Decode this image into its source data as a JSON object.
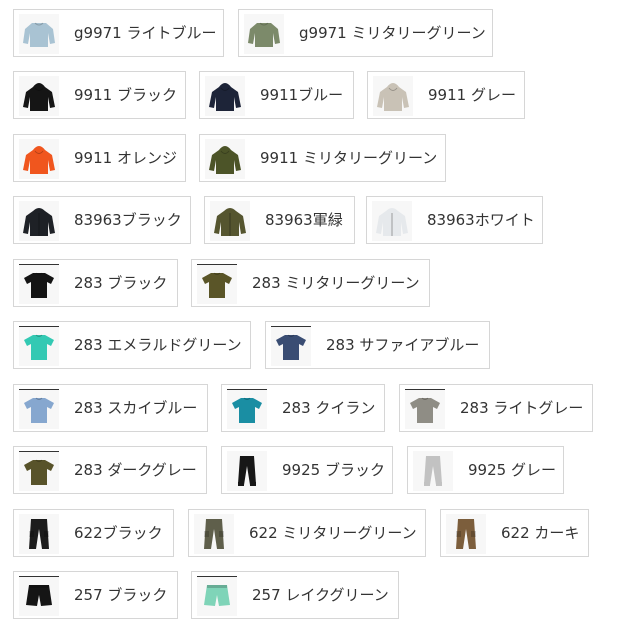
{
  "options": [
    {
      "label": "g9971 ライトブルー",
      "icon": "sweatshirt-icon",
      "color": "#a9c3d3"
    },
    {
      "label": "g9971 ミリタリーグリーン",
      "icon": "sweatshirt-icon",
      "color": "#7c8a6a"
    },
    {
      "label": "9911 ブラック",
      "icon": "hoodie-icon",
      "color": "#151515"
    },
    {
      "label": "9911ブルー",
      "icon": "hoodie-icon",
      "color": "#1d2438"
    },
    {
      "label": "9911 グレー",
      "icon": "hoodie-icon",
      "color": "#c9c2b6"
    },
    {
      "label": "9911 オレンジ",
      "icon": "hoodie-icon",
      "color": "#f0561e"
    },
    {
      "label": "9911 ミリタリーグリーン",
      "icon": "hoodie-icon",
      "color": "#4c5428"
    },
    {
      "label": "83963ブラック",
      "icon": "jacket-icon",
      "color": "#1e2126"
    },
    {
      "label": "83963軍緑",
      "icon": "jacket-icon",
      "color": "#55552f"
    },
    {
      "label": "83963ホワイト",
      "icon": "jacket-icon",
      "color": "#e6e9ec"
    },
    {
      "label": "283 ブラック",
      "icon": "tshirt-icon",
      "color": "#141414"
    },
    {
      "label": "283 ミリタリーグリーン",
      "icon": "tshirt-icon",
      "color": "#5a5528"
    },
    {
      "label": "283 エメラルドグリーン",
      "icon": "tshirt-icon",
      "color": "#33c9b3"
    },
    {
      "label": "283 サファイアブルー",
      "icon": "tshirt-icon",
      "color": "#3a4d73"
    },
    {
      "label": "283 スカイブルー",
      "icon": "tshirt-icon",
      "color": "#86a7cf"
    },
    {
      "label": "283 クイラン",
      "icon": "tshirt-icon",
      "color": "#1a8ea3"
    },
    {
      "label": "283 ライトグレー",
      "icon": "tshirt-icon",
      "color": "#8f8d85"
    },
    {
      "label": "283 ダークグレー",
      "icon": "tshirt-icon",
      "color": "#58532a"
    },
    {
      "label": "9925 ブラック",
      "icon": "joggers-icon",
      "color": "#171717"
    },
    {
      "label": "9925 グレー",
      "icon": "joggers-icon",
      "color": "#c2c2c2"
    },
    {
      "label": "622ブラック",
      "icon": "cargo-pants-icon",
      "color": "#1c1c1c"
    },
    {
      "label": "622 ミリタリーグリーン",
      "icon": "cargo-pants-icon",
      "color": "#5f5f4b"
    },
    {
      "label": "622 カーキ",
      "icon": "cargo-pants-icon",
      "color": "#7c5e3c"
    },
    {
      "label": "257 ブラック",
      "icon": "shorts-icon",
      "color": "#151515"
    },
    {
      "label": "257 レイクグリーン",
      "icon": "shorts-icon",
      "color": "#7fd4b8"
    }
  ]
}
